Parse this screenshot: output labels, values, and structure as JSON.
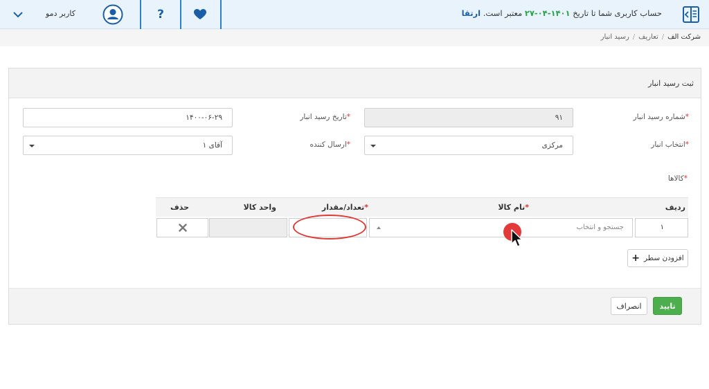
{
  "topbar": {
    "notice_prefix": "حساب کاربری شما تا تاریخ",
    "expiry_date": "۱۴۰۱-۰۴-۲۷",
    "notice_suffix": "معتبر است.",
    "upgrade_label": "ارتقا",
    "user_name": "کاربر دمو",
    "icons": [
      "sidebar-toggle-icon",
      "heart-icon",
      "help-icon",
      "user-icon",
      "chevron-down-icon"
    ]
  },
  "breadcrumb": [
    "شرکت الف",
    "تعاریف",
    "رسید انبار"
  ],
  "form": {
    "title": "ثبت رسید انبار",
    "receipt_number_label": "شماره رسید انبار",
    "receipt_number_value": "۹۱",
    "receipt_date_label": "تاریخ رسید انبار",
    "receipt_date_value": "۱۴۰۰-۰۶-۲۹",
    "warehouse_label": "انتخاب انبار",
    "warehouse_value": "مرکزی",
    "sender_label": "ارسال کننده",
    "sender_value": "آقای ۱",
    "goods_label": "کالاها"
  },
  "table": {
    "headers": {
      "row": "ردیف",
      "product_name": "نام کالا",
      "quantity": "تعداد/مقدار",
      "unit": "واحد کالا",
      "delete": "حذف"
    },
    "rows": [
      {
        "row": "۱",
        "product_placeholder": "جستجو و انتخاب",
        "quantity": "",
        "unit": ""
      }
    ],
    "add_row_label": "افزودن سطر"
  },
  "footer": {
    "confirm_label": "تایید",
    "cancel_label": "انصراف"
  },
  "colors": {
    "accent": "#2b7fd0",
    "confirm": "#4cae4c",
    "highlight": "#e03a36"
  }
}
